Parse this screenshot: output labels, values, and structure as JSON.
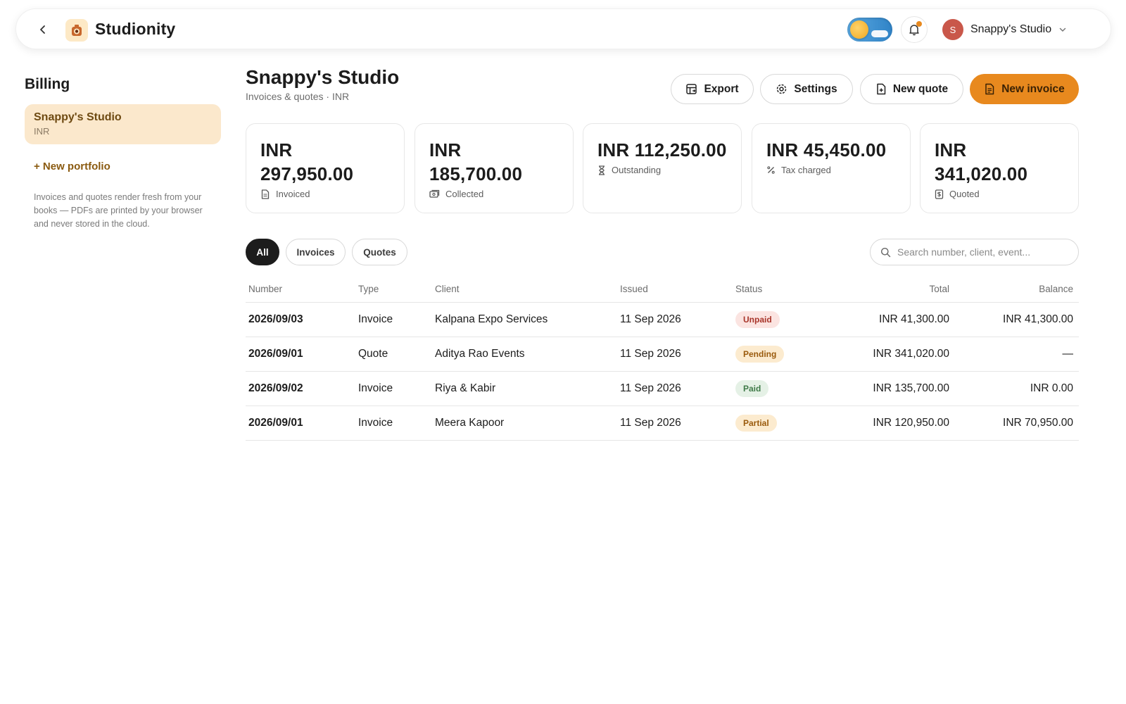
{
  "app": {
    "title": "Studionity"
  },
  "user": {
    "initial": "S",
    "name": "Snappy's Studio"
  },
  "sidebar": {
    "title": "Billing",
    "portfolio": {
      "name": "Snappy's Studio",
      "currency": "INR"
    },
    "new_portfolio": "+ New portfolio",
    "note": "Invoices and quotes render fresh from your books — PDFs are printed by your browser and never stored in the cloud."
  },
  "header": {
    "title": "Snappy's Studio",
    "subtitle": "Invoices & quotes · INR",
    "buttons": {
      "export": "Export",
      "settings": "Settings",
      "new_quote": "New quote",
      "new_invoice": "New invoice"
    }
  },
  "stats": [
    {
      "value": "INR 297,950.00",
      "label": "Invoiced",
      "icon": "document-icon"
    },
    {
      "value": "INR 185,700.00",
      "label": "Collected",
      "icon": "cash-icon"
    },
    {
      "value": "INR 112,250.00",
      "label": "Outstanding",
      "icon": "hourglass-icon"
    },
    {
      "value": "INR 45,450.00",
      "label": "Tax charged",
      "icon": "percent-icon"
    },
    {
      "value": "INR 341,020.00",
      "label": "Quoted",
      "icon": "receipt-icon"
    }
  ],
  "filters": {
    "all": "All",
    "invoices": "Invoices",
    "quotes": "Quotes",
    "active": "All"
  },
  "search": {
    "placeholder": "Search number, client, event..."
  },
  "table": {
    "columns": {
      "number": "Number",
      "type": "Type",
      "client": "Client",
      "issued": "Issued",
      "status": "Status",
      "total": "Total",
      "balance": "Balance"
    },
    "rows": [
      {
        "number": "2026/09/03",
        "type": "Invoice",
        "client": "Kalpana Expo Services",
        "issued": "11 Sep 2026",
        "status": "Unpaid",
        "total": "INR 41,300.00",
        "balance": "INR 41,300.00"
      },
      {
        "number": "2026/09/01",
        "type": "Quote",
        "client": "Aditya Rao Events",
        "issued": "11 Sep 2026",
        "status": "Pending",
        "total": "INR 341,020.00",
        "balance": "—"
      },
      {
        "number": "2026/09/02",
        "type": "Invoice",
        "client": "Riya & Kabir",
        "issued": "11 Sep 2026",
        "status": "Paid",
        "total": "INR 135,700.00",
        "balance": "INR 0.00"
      },
      {
        "number": "2026/09/01",
        "type": "Invoice",
        "client": "Meera Kapoor",
        "issued": "11 Sep 2026",
        "status": "Partial",
        "total": "INR 120,950.00",
        "balance": "INR 70,950.00"
      }
    ]
  },
  "colors": {
    "accent": "#e8891e",
    "portfolio_bg": "#fbe8cc",
    "avatar": "#c9574a"
  }
}
